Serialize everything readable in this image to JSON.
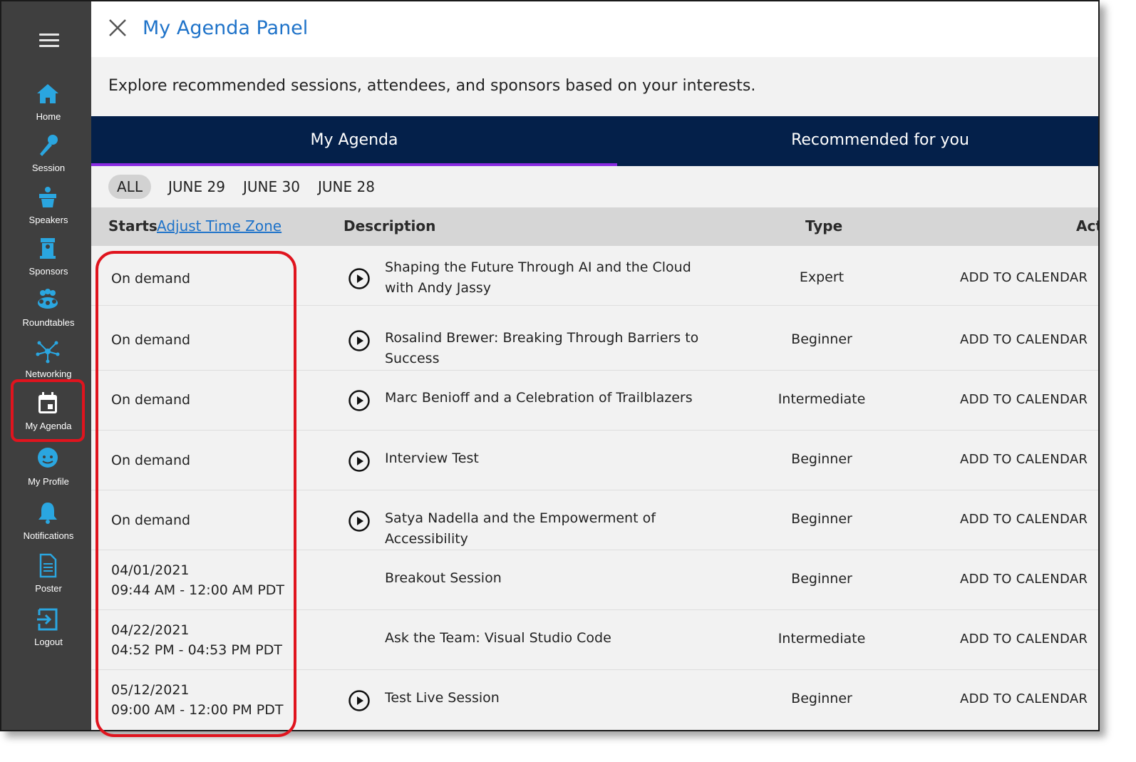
{
  "sidebar": {
    "menu_icon": "hamburger-icon",
    "items": [
      {
        "label": "Home",
        "icon": "home-icon"
      },
      {
        "label": "Session",
        "icon": "microphone-icon"
      },
      {
        "label": "Speakers",
        "icon": "podium-icon"
      },
      {
        "label": "Sponsors",
        "icon": "sponsor-booth-icon"
      },
      {
        "label": "Roundtables",
        "icon": "group-icon"
      },
      {
        "label": "Networking",
        "icon": "network-icon"
      },
      {
        "label": "My Agenda",
        "icon": "calendar-icon"
      },
      {
        "label": "My Profile",
        "icon": "face-icon"
      },
      {
        "label": "Notifications",
        "icon": "bell-icon"
      },
      {
        "label": "Poster",
        "icon": "document-icon"
      },
      {
        "label": "Logout",
        "icon": "logout-icon"
      }
    ],
    "icon_color": "#2aa6e0",
    "background": "#3f3f3f"
  },
  "panel": {
    "title": "My Agenda Panel",
    "subtitle": "Explore recommended sessions, attendees, and sponsors based on your interests.",
    "tabs": [
      {
        "label": "My Agenda",
        "active": true
      },
      {
        "label": "Recommended for you",
        "active": false
      }
    ],
    "tab_bar_color": "#04204a",
    "active_tab_underline": "#8a2be2"
  },
  "date_filters": [
    "ALL",
    "JUNE 29",
    "JUNE 30",
    "JUNE 28"
  ],
  "table": {
    "headers": {
      "starts": "Starts",
      "adjust_tz": "Adjust Time Zone",
      "description": "Description",
      "type": "Type",
      "action": "Act"
    },
    "rows": [
      {
        "start1": "On demand",
        "start2": "",
        "description": "Shaping the Future Through AI and the Cloud with Andy Jassy",
        "type": "Expert",
        "action": "ADD TO CALENDAR",
        "has_play": true
      },
      {
        "start1": "On demand",
        "start2": "",
        "description": "Rosalind Brewer: Breaking Through Barriers to Success",
        "type": "Beginner",
        "action": "ADD TO CALENDAR",
        "has_play": true
      },
      {
        "start1": "On demand",
        "start2": "",
        "description": "Marc Benioff and a Celebration of Trailblazers",
        "type": "Intermediate",
        "action": "ADD TO CALENDAR",
        "has_play": true
      },
      {
        "start1": "On demand",
        "start2": "",
        "description": "Interview Test",
        "type": "Beginner",
        "action": "ADD TO CALENDAR",
        "has_play": true
      },
      {
        "start1": "On demand",
        "start2": "",
        "description": "Satya Nadella and the Empowerment of Accessibility",
        "type": "Beginner",
        "action": "ADD TO CALENDAR",
        "has_play": true
      },
      {
        "start1": "04/01/2021",
        "start2": "09:44 AM - 12:00 AM PDT",
        "description": "Breakout Session",
        "type": "Beginner",
        "action": "ADD TO CALENDAR",
        "has_play": false
      },
      {
        "start1": "04/22/2021",
        "start2": "04:52 PM - 04:53 PM PDT",
        "description": "Ask the Team: Visual Studio Code",
        "type": "Intermediate",
        "action": "ADD TO CALENDAR",
        "has_play": false
      },
      {
        "start1": "05/12/2021",
        "start2": "09:00 AM - 12:00 PM PDT",
        "description": "Test Live Session",
        "type": "Beginner",
        "action": "ADD TO CALENDAR",
        "has_play": true
      }
    ]
  },
  "annotation_color": "#e0141e"
}
